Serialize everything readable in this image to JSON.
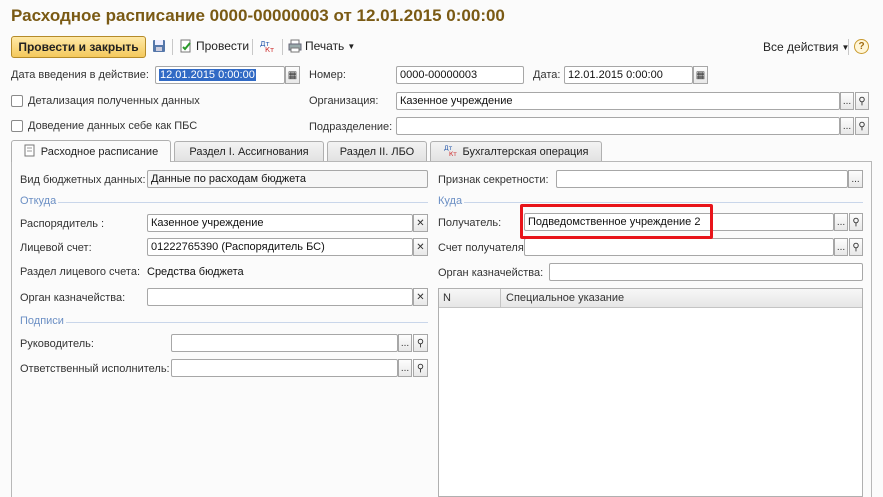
{
  "title": "Расходное расписание 0000-00000003 от 12.01.2015 0:00:00",
  "toolbar": {
    "post_close": "Провести и закрыть",
    "post": "Провести",
    "print": "Печать",
    "all_actions": "Все действия",
    "help": "?"
  },
  "header": {
    "effective_date_label": "Дата введения в действие:",
    "effective_date_value": "12.01.2015  0:00:00",
    "number_label": "Номер:",
    "number_value": "0000-00000003",
    "date_label": "Дата:",
    "date_value": "12.01.2015  0:00:00",
    "detail_label": "Детализация полученных данных",
    "pbs_label": "Доведение данных себе как ПБС",
    "org_label": "Организация:",
    "org_value": "Казенное учреждение",
    "subdivision_label": "Подразделение:",
    "subdivision_value": ""
  },
  "tabs": [
    {
      "label": "Расходное расписание"
    },
    {
      "label": "Раздел I. Ассигнования"
    },
    {
      "label": "Раздел II. ЛБО"
    },
    {
      "label": "Бухгалтерская операция"
    }
  ],
  "main": {
    "budget_data_label": "Вид бюджетных данных:",
    "budget_data_value": "Данные по расходам бюджета",
    "secrecy_label": "Признак секретности:",
    "secrecy_value": "",
    "from_section": "Откуда",
    "to_section": "Куда",
    "manager_label": "Распорядитель :",
    "manager_value": "Казенное учреждение",
    "recipient_label": "Получатель:",
    "recipient_value": "Подведомственное  учреждение 2",
    "account_label": "Лицевой счет:",
    "account_value": "01222765390 (Распорядитель БС)",
    "recipient_account_label": "Счет получателя:",
    "recipient_account_value": "",
    "account_section_label": "Раздел лицевого счета:",
    "account_section_value": "Средства бюджета",
    "treasury_right_label": "Орган казначейства:",
    "treasury_right_value": "",
    "treasury_left_label": "Орган казначейства:",
    "treasury_left_value": "",
    "grid_col_n": "N",
    "grid_col_note": "Специальное указание",
    "signatures_section": "Подписи",
    "head_label": "Руководитель:",
    "head_value": "",
    "executor_label": "Ответственный исполнитель:",
    "executor_value": ""
  },
  "icons": {
    "ellipsis": "...",
    "clear": "✕"
  }
}
